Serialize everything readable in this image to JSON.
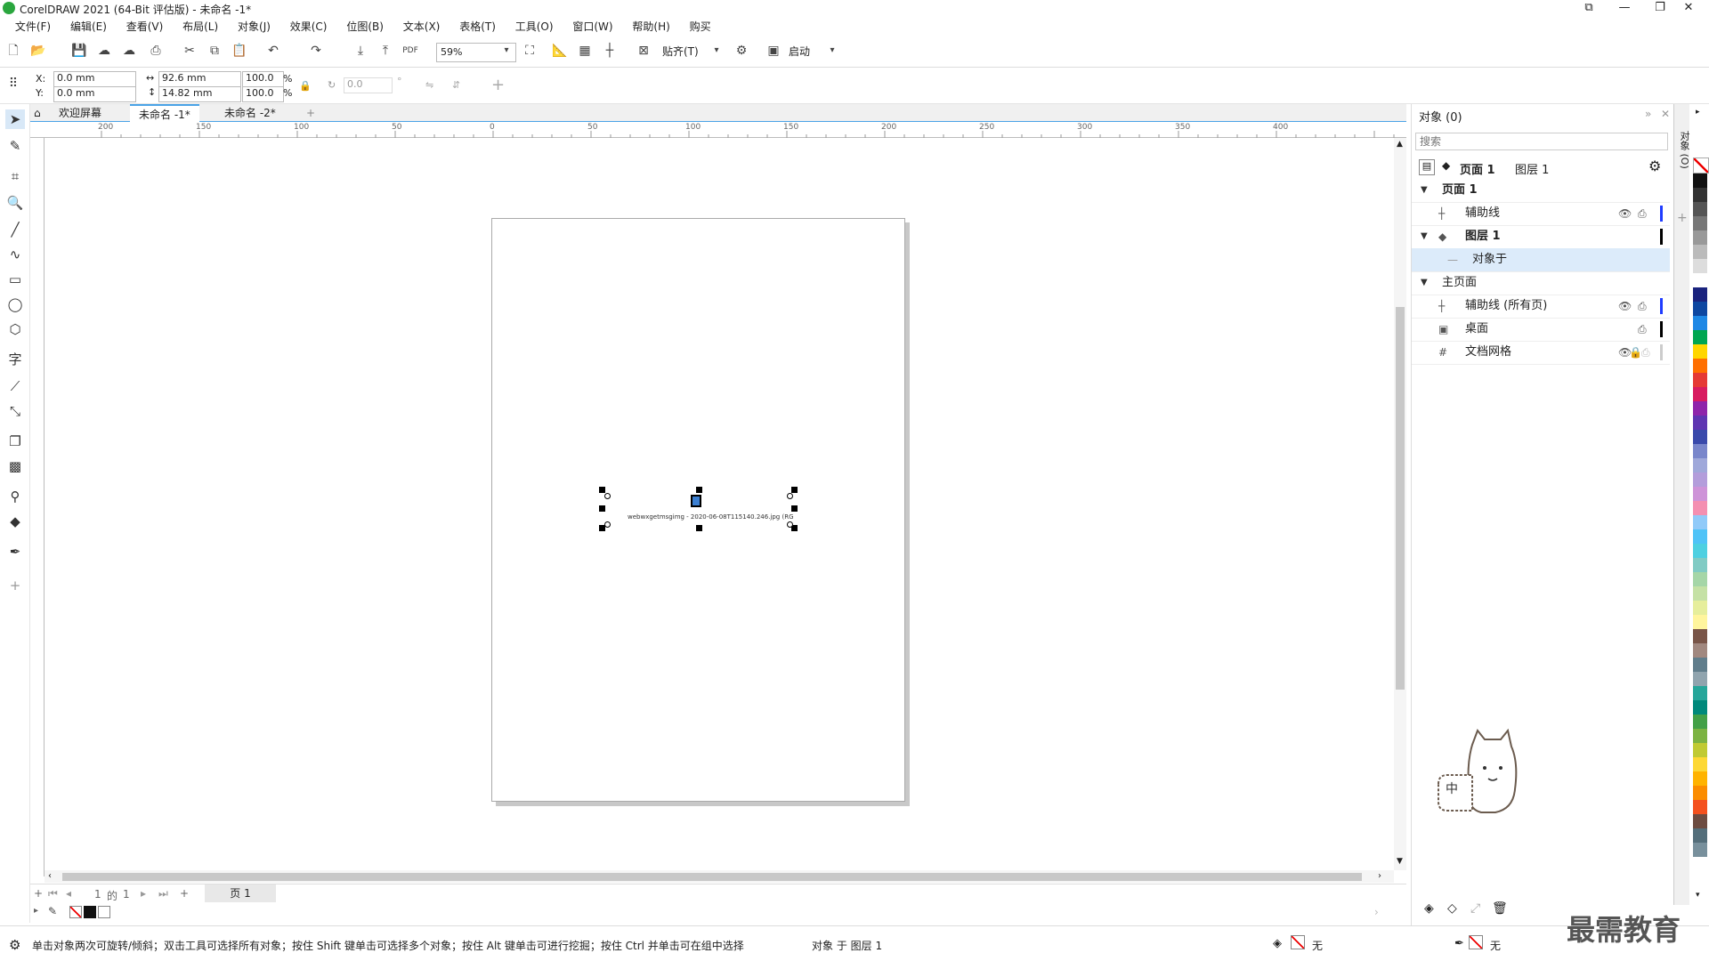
{
  "window": {
    "title": "CorelDRAW 2021 (64-Bit 评估版) - 未命名 -1*"
  },
  "menu": [
    "文件(F)",
    "编辑(E)",
    "查看(V)",
    "布局(L)",
    "对象(J)",
    "效果(C)",
    "位图(B)",
    "文本(X)",
    "表格(T)",
    "工具(O)",
    "窗口(W)",
    "帮助(H)",
    "购买"
  ],
  "toolbar": {
    "zoom": "59%",
    "snap_label": "贴齐(T)",
    "launch_label": "启动"
  },
  "propbar": {
    "x": "0.0 mm",
    "y": "0.0 mm",
    "w": "92.6 mm",
    "h": "14.82 mm",
    "sx": "100.0",
    "sy": "100.0",
    "pct": "%",
    "angle": "0.0",
    "x_label": "X:",
    "y_label": "Y:"
  },
  "tabs": [
    "欢迎屏幕",
    "未命名 -1*",
    "未命名 -2*"
  ],
  "ruler_top": [
    "200",
    "150",
    "100",
    "50",
    "0",
    "50",
    "100",
    "150",
    "200",
    "250",
    "300",
    "350",
    "400"
  ],
  "canvas": {
    "object_label": "webwxgetmsgimg - 2020-06-08T115140.246.jpg (RG"
  },
  "pagenav": {
    "current": "1",
    "of": "的",
    "total": "1",
    "page_tab": "页 1"
  },
  "status": {
    "hint": "单击对象两次可旋转/倾斜；双击工具可选择所有对象；按住 Shift 键单击可选择多个对象；按住 Alt 键单击可进行挖掘；按住 Ctrl 并单击可在组中选择",
    "selection": "对象 于 图层 1",
    "fill_none": "无",
    "outline_none": "无"
  },
  "objects_panel": {
    "title": "对象 (0)",
    "search_placeholder": "搜索",
    "page_label": "页面 1",
    "layer_label": "图层 1",
    "rows": [
      {
        "label": "页面 1",
        "bold": true
      },
      {
        "label": "辅助线"
      },
      {
        "label": "图层 1",
        "bold": true
      },
      {
        "label": "对象于"
      },
      {
        "label": "主页面"
      },
      {
        "label": "辅助线 (所有页)"
      },
      {
        "label": "桌面"
      },
      {
        "label": "文档网格"
      }
    ]
  },
  "side_tab_label": "对象 (O)",
  "watermark": "最需教育",
  "colors": {
    "accent": "#4aa3e6",
    "selection_row": "#dcebfa",
    "bar_blue": "#1f3cff",
    "bar_black": "#000000"
  }
}
